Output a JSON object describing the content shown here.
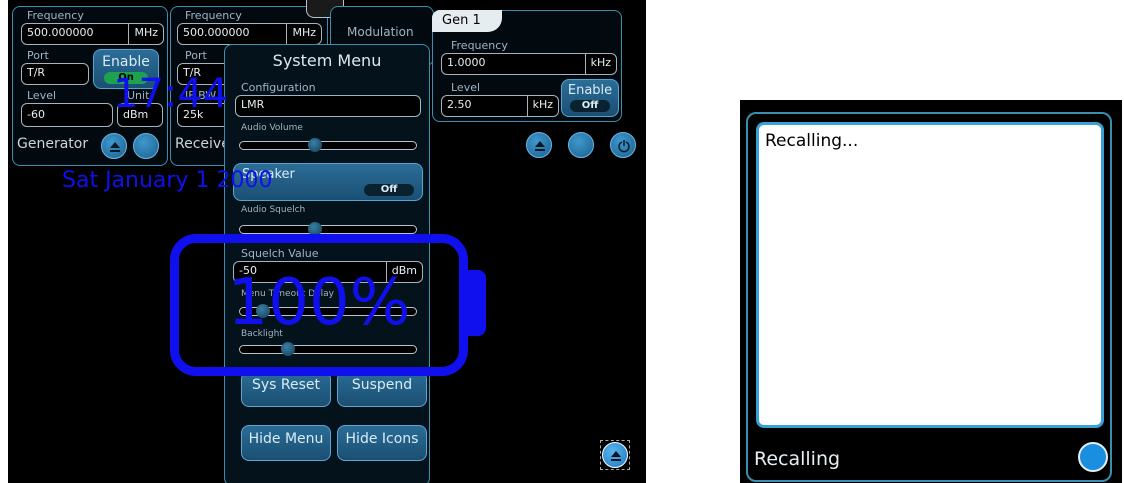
{
  "generator": {
    "frequency_label": "Frequency",
    "frequency_value": "500.000000",
    "frequency_unit": "MHz",
    "port_label": "Port",
    "port_value": "T/R",
    "enable_label": "Enable",
    "enable_state": "On",
    "level_label": "Level",
    "level_value": "-60",
    "unit_label": "Unit",
    "unit_value": "dBm",
    "panel_label": "Generator"
  },
  "receiver": {
    "frequency_label": "Frequency",
    "frequency_value": "500.000000",
    "frequency_unit": "MHz",
    "port_label": "Port",
    "port_value": "T/R",
    "ifbw_label": "IF BW",
    "ifbw_value": "25k",
    "panel_label": "Receive"
  },
  "modulation": {
    "label": "Modulation"
  },
  "gen1": {
    "tab_label": "Gen 1",
    "frequency_label": "Frequency",
    "frequency_value": "1.0000",
    "frequency_unit": "kHz",
    "level_label": "Level",
    "level_value": "2.50",
    "level_unit": "kHz",
    "enable_label": "Enable",
    "enable_state": "Off"
  },
  "overlay": {
    "time": "17:44",
    "date": "Sat January 1 2000",
    "battery_percent": "100%",
    "battery_level": 1.0
  },
  "system_menu": {
    "title": "System Menu",
    "configuration_label": "Configuration",
    "configuration_value": "LMR",
    "audio_volume_label": "Audio Volume",
    "audio_volume_level": 0.42,
    "speaker_label": "Speaker",
    "speaker_state": "Off",
    "audio_squelch_label": "Audio Squelch",
    "audio_squelch_level": 0.42,
    "squelch_value_label": "Squelch Value",
    "squelch_value": "-50",
    "squelch_unit": "dBm",
    "menu_timeout_label": "Menu Timeout Delay",
    "menu_timeout_level": 0.1,
    "backlight_label": "Backlight",
    "backlight_level": 0.25,
    "sys_reset_label": "Sys Reset",
    "suspend_label": "Suspend",
    "hide_menu_label": "Hide Menu",
    "hide_icons_label": "Hide Icons"
  },
  "recall_dialog": {
    "message": "Recalling...",
    "title": "Recalling"
  },
  "colors": {
    "panel_border": "#3a8fb0",
    "accent_blue": "#1010ee",
    "button_blue": "#1a8fe0"
  },
  "icons": [
    "eject-icon",
    "circle-button-icon",
    "power-icon"
  ]
}
